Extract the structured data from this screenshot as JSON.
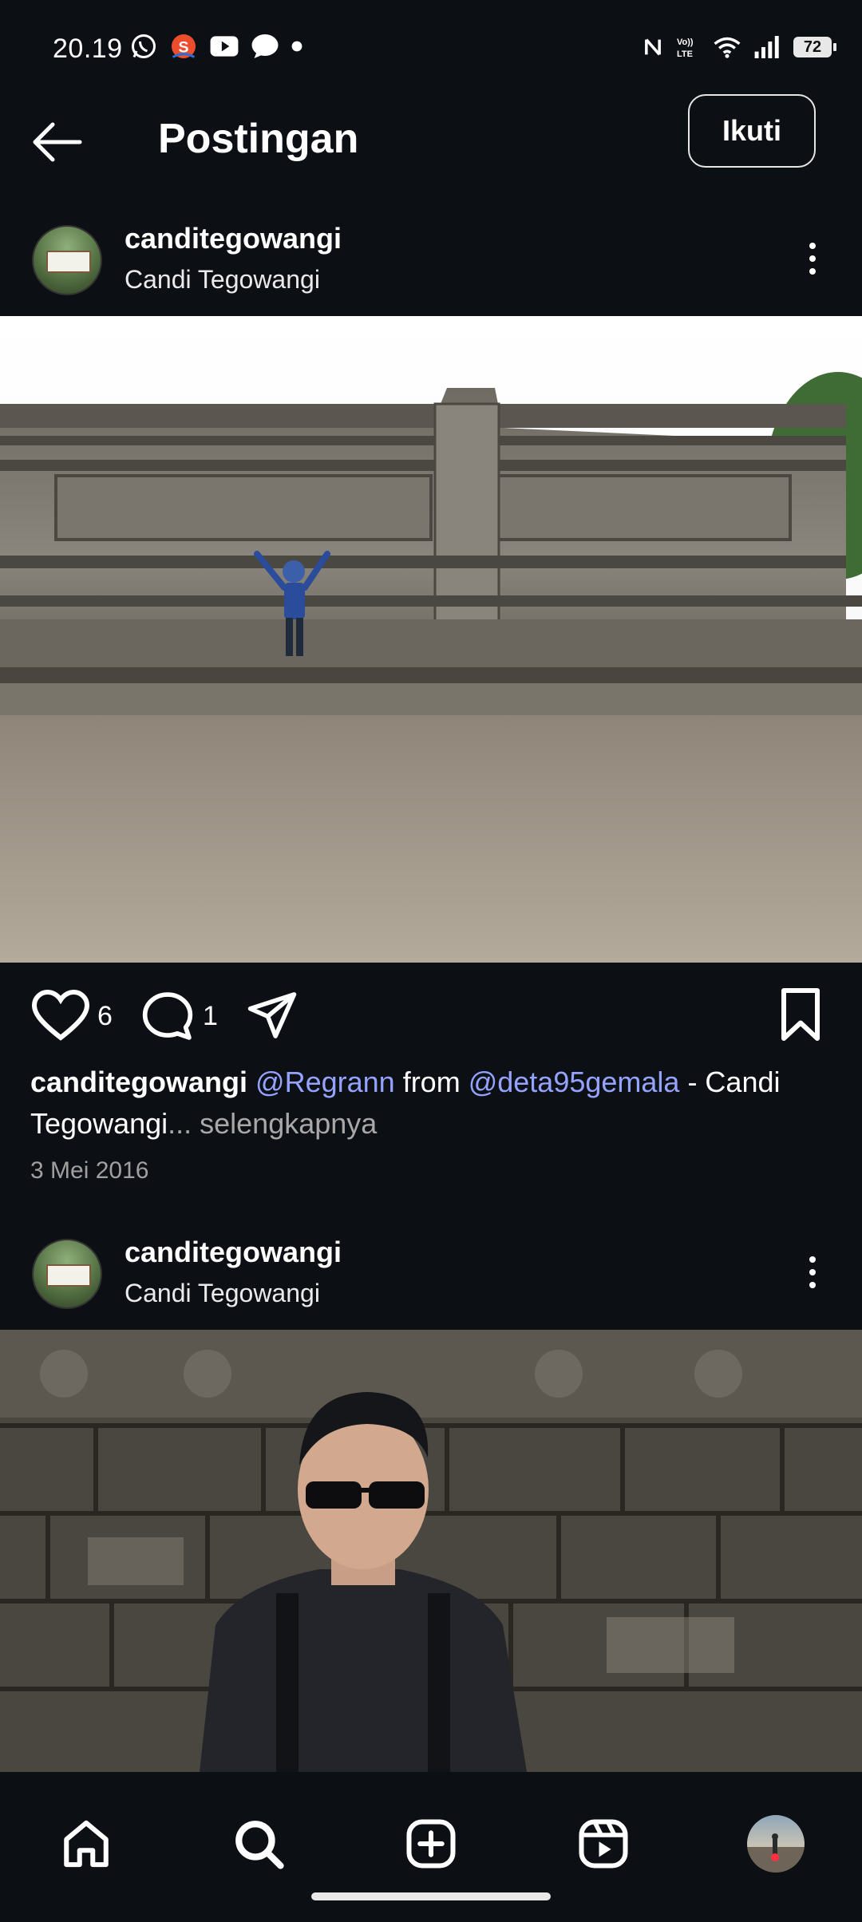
{
  "status_bar": {
    "time": "20.19",
    "battery": "72",
    "icons_left": [
      "whatsapp-icon",
      "shopee-icon",
      "youtube-icon",
      "message-icon",
      "dot-icon"
    ],
    "icons_right": [
      "nfc-icon",
      "volte-icon",
      "wifi-icon",
      "signal-icon",
      "battery-icon"
    ]
  },
  "header": {
    "title": "Postingan",
    "follow_label": "Ikuti"
  },
  "posts": [
    {
      "username": "canditegowangi",
      "location": "Candi Tegowangi",
      "likes": "6",
      "comments": "1",
      "caption_user": "canditegowangi",
      "caption_mention1": "@Regrann",
      "caption_from": " from ",
      "caption_mention2": "@deta95gemala",
      "caption_text": " -  Candi Tegowangi",
      "caption_more": "... selengkapnya",
      "date": "3 Mei 2016"
    },
    {
      "username": "canditegowangi",
      "location": "Candi Tegowangi"
    }
  ],
  "nav": {
    "items": [
      "home-icon",
      "search-icon",
      "create-icon",
      "reels-icon",
      "profile-avatar"
    ]
  },
  "colors": {
    "background": "#0c0f14",
    "mention": "#94a3ff",
    "notification_dot": "#ff3040"
  }
}
